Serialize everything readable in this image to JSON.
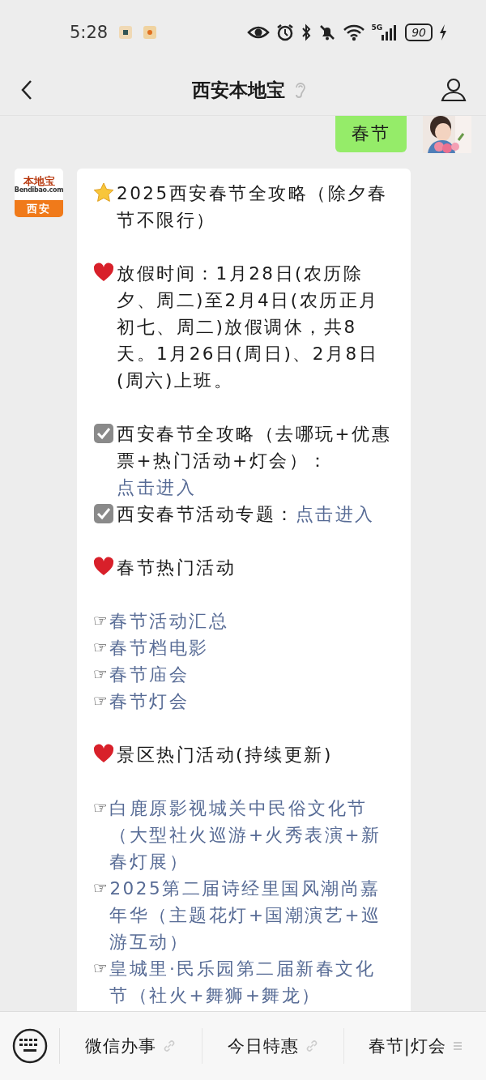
{
  "status_bar": {
    "time": "5:28",
    "network": "5G",
    "battery": "90",
    "charging": true
  },
  "header": {
    "title": "西安本地宝",
    "earpiece": true
  },
  "messages": [
    {
      "kind": "outgoing",
      "text": "春节"
    },
    {
      "kind": "incoming",
      "logo": {
        "brand": "本地宝",
        "site": "Bendibao.com",
        "city": "西安"
      },
      "groups": [
        {
          "items": [
            {
              "kind": "star",
              "text": "2025西安春节全攻略（除夕春节不限行）"
            }
          ]
        },
        {
          "items": [
            {
              "kind": "heart",
              "text": "放假时间：1月28日(农历除夕、周二)至2月4日(农历正月初七、周二)放假调休，共8天。1月26日(周日)、2月8日(周六)上班。"
            }
          ]
        },
        {
          "items": [
            {
              "kind": "check",
              "text": "西安春节全攻略（去哪玩+优惠票+热门活动+灯会）：",
              "link": "点击进入"
            },
            {
              "kind": "check",
              "text": "西安春节活动专题：",
              "link": "点击进入"
            }
          ]
        },
        {
          "items": [
            {
              "kind": "heart",
              "text": "春节热门活动"
            }
          ]
        },
        {
          "items": [
            {
              "kind": "pointer",
              "marker": "☞",
              "link": "春节活动汇总"
            },
            {
              "kind": "pointer",
              "marker": "☞",
              "link": "春节档电影"
            },
            {
              "kind": "pointer",
              "marker": "☞",
              "link": "春节庙会"
            },
            {
              "kind": "pointer",
              "marker": "☞",
              "link": "春节灯会"
            }
          ]
        },
        {
          "items": [
            {
              "kind": "heart",
              "text": "景区热门活动(持续更新)"
            }
          ]
        },
        {
          "items": [
            {
              "kind": "pointer",
              "marker": "☞",
              "link": "白鹿原影视城关中民俗文化节（大型社火巡游+火秀表演+新春灯展）"
            },
            {
              "kind": "pointer",
              "marker": "☞",
              "link": "2025第二届诗经里国风潮尚嘉年华（主题花灯+国潮演艺+巡游互动）"
            },
            {
              "kind": "pointer",
              "marker": "☞",
              "link": "皇城里·民乐园第二届新春文化节（社火+舞狮+舞龙）"
            }
          ]
        }
      ]
    }
  ],
  "menu_bar": [
    {
      "label": "微信办事",
      "kind": "link"
    },
    {
      "label": "今日特惠",
      "kind": "link"
    },
    {
      "label": "春节|灯会",
      "kind": "submenu"
    }
  ]
}
